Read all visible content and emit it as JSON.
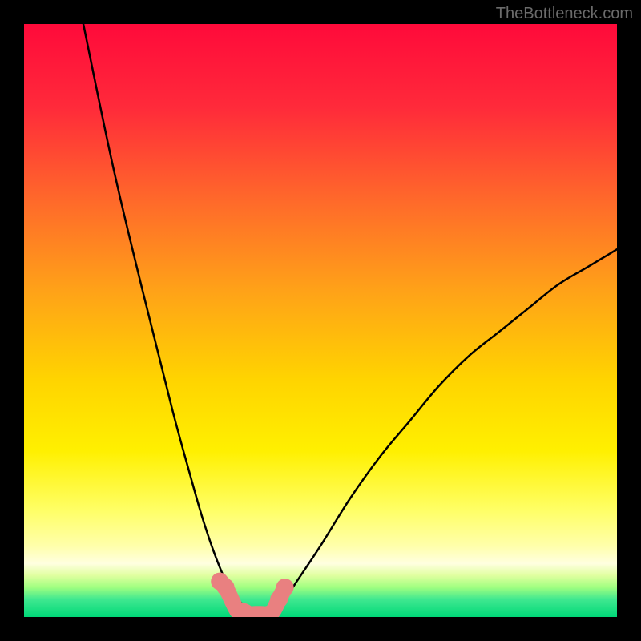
{
  "watermark": "TheBottleneck.com",
  "chart_data": {
    "type": "line",
    "title": "",
    "xlabel": "",
    "ylabel": "",
    "xlim": [
      0,
      100
    ],
    "ylim": [
      0,
      100
    ],
    "grid": false,
    "series": [
      {
        "name": "curve-left",
        "x": [
          10,
          15,
          20,
          25,
          28,
          30,
          32,
          34,
          35,
          36,
          37,
          38
        ],
        "y": [
          100,
          76,
          55,
          35,
          24,
          17,
          11,
          6,
          4,
          3,
          2,
          1
        ]
      },
      {
        "name": "curve-right",
        "x": [
          42,
          44,
          46,
          50,
          55,
          60,
          65,
          70,
          75,
          80,
          85,
          90,
          95,
          100
        ],
        "y": [
          1,
          3,
          6,
          12,
          20,
          27,
          33,
          39,
          44,
          48,
          52,
          56,
          59,
          62
        ]
      },
      {
        "name": "bottom-markers",
        "x": [
          33,
          34,
          36,
          37,
          38,
          39,
          40,
          41,
          42,
          43,
          44
        ],
        "y": [
          6,
          5,
          1,
          1,
          0.5,
          0.5,
          0.5,
          0.5,
          1,
          3,
          5
        ]
      }
    ],
    "colors": {
      "gradient_top": "#ff0a3a",
      "gradient_mid1": "#ff7a2a",
      "gradient_mid2": "#ffd800",
      "gradient_mid3": "#ffff66",
      "gradient_bottom": "#00e676",
      "curve": "#000000",
      "marker": "#e98080"
    }
  }
}
